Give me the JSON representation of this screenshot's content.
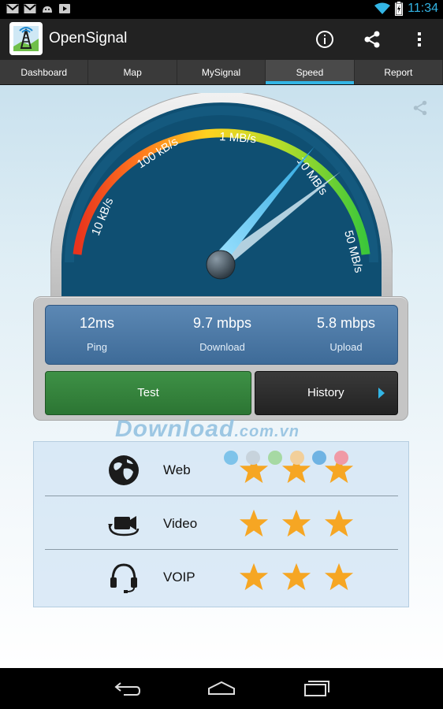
{
  "status": {
    "time": "11:34"
  },
  "app": {
    "title": "OpenSignal"
  },
  "tabs": [
    {
      "label": "Dashboard"
    },
    {
      "label": "Map"
    },
    {
      "label": "MySignal"
    },
    {
      "label": "Speed",
      "active": true
    },
    {
      "label": "Report"
    }
  ],
  "gauge": {
    "scale_labels": [
      "10 kB/s",
      "100 kB/s",
      "1 MB/s",
      "10 MB/s",
      "50 MB/s"
    ],
    "colors": {
      "face": "#0f4f72",
      "bezel": "#d7d7d7",
      "arc_start": "#e8331d",
      "arc_mid": "#ffd21f",
      "arc_end": "#3cc73a"
    }
  },
  "stats": {
    "ping": {
      "value": "12ms",
      "label": "Ping"
    },
    "download": {
      "value": "9.7 mbps",
      "label": "Download"
    },
    "upload": {
      "value": "5.8 mbps",
      "label": "Upload"
    }
  },
  "buttons": {
    "test": "Test",
    "history": "History"
  },
  "watermark": {
    "text": "Download",
    "suffix": ".com.vn"
  },
  "quality": [
    {
      "label": "Web",
      "icon": "globe-icon",
      "stars": 3
    },
    {
      "label": "Video",
      "icon": "video-camera-icon",
      "stars": 3
    },
    {
      "label": "VOIP",
      "icon": "headset-icon",
      "stars": 3
    }
  ],
  "colors": {
    "accent": "#33b5e5",
    "star": "#f6a623",
    "test_button": "#2f7d36"
  }
}
